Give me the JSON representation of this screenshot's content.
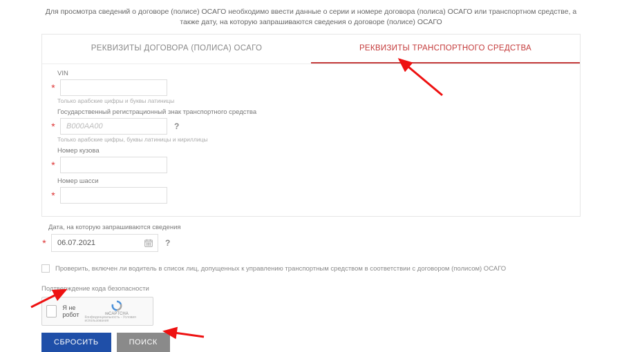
{
  "intro": "Для просмотра сведений о договоре (полисе) ОСАГО необходимо ввести данные о серии и номере договора (полиса) ОСАГО или транспортном средстве, а также дату, на которую запрашиваются сведения о договоре (полисе) ОСАГО",
  "tabs": {
    "policy": "РЕКВИЗИТЫ ДОГОВОРА (ПОЛИСА) ОСАГО",
    "vehicle": "РЕКВИЗИТЫ ТРАНСПОРТНОГО СРЕДСТВА"
  },
  "fields": {
    "vin": {
      "label": "VIN",
      "hint": "Только арабские цифры и буквы латиницы"
    },
    "plate": {
      "label": "Государственный регистрационный знак транспортного средства",
      "placeholder": "В000АА00",
      "hint": "Только арабские цифры, буквы латиницы и кириллицы"
    },
    "body": {
      "label": "Номер кузова"
    },
    "chassis": {
      "label": "Номер шасси"
    }
  },
  "date": {
    "label": "Дата, на которую запрашиваются сведения",
    "value": "06.07.2021"
  },
  "driver_check": "Проверить, включен ли водитель в список лиц, допущенных к управлению транспортным средством в соответствии с договором (полисом) ОСАГО",
  "captcha": {
    "section_label": "Подтверждение кода безопасности",
    "robot": "Я не робот",
    "brand": "reCAPTCHA",
    "sub": "Конфиденциальность - Условия использования"
  },
  "buttons": {
    "reset": "СБРОСИТЬ",
    "search": "ПОИСК"
  },
  "asterisk": "*",
  "qmark": "?"
}
